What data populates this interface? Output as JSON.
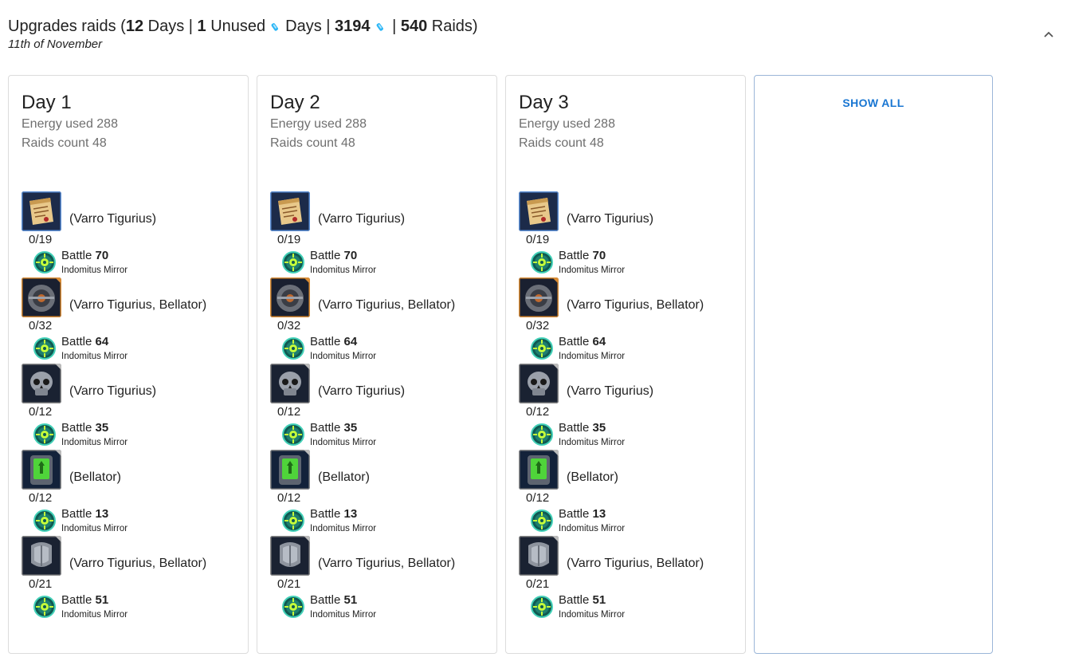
{
  "header": {
    "title_prefix": "Upgrades raids (",
    "days_value": "12",
    "days_label": " Days | ",
    "unused_value": "1",
    "unused_label": " Unused",
    "energy_days_label": "Days | ",
    "energy_total": "3194",
    "raids_sep": " | ",
    "raids_value": "540",
    "raids_label": " Raids)",
    "date": "11th of November",
    "energy_icon": "energy-icon",
    "collapse_icon": "chevron-up-icon"
  },
  "days": [
    {
      "title": "Day 1",
      "energy": "Energy used 288",
      "raids": "Raids count 48"
    },
    {
      "title": "Day 2",
      "energy": "Energy used 288",
      "raids": "Raids count 48"
    },
    {
      "title": "Day 3",
      "energy": "Energy used 288",
      "raids": "Raids count 48"
    }
  ],
  "upgrades": [
    {
      "icon": "scroll-icon",
      "rarity_color": "#5b8fd6",
      "characters": "(Varro Tigurius)",
      "progress": "0/19",
      "battle_label": "Battle ",
      "battle_number": "70",
      "campaign": "Indomitus Mirror"
    },
    {
      "icon": "armor-plate-icon",
      "rarity_color": "#d98b33",
      "characters": "(Varro Tigurius, Bellator)",
      "progress": "0/32",
      "battle_label": "Battle ",
      "battle_number": "64",
      "campaign": "Indomitus Mirror"
    },
    {
      "icon": "skull-icon",
      "rarity_color": "#8a8a8a",
      "characters": "(Varro Tigurius)",
      "progress": "0/12",
      "battle_label": "Battle ",
      "battle_number": "35",
      "campaign": "Indomitus Mirror"
    },
    {
      "icon": "data-slate-icon",
      "rarity_color": "#8a8a8a",
      "characters": "(Bellator)",
      "progress": "0/12",
      "battle_label": "Battle ",
      "battle_number": "13",
      "campaign": "Indomitus Mirror"
    },
    {
      "icon": "pauldron-icon",
      "rarity_color": "#8a8a8a",
      "characters": "(Varro Tigurius, Bellator)",
      "progress": "0/21",
      "battle_label": "Battle ",
      "battle_number": "51",
      "campaign": "Indomitus Mirror"
    }
  ],
  "location_icon": "campaign-location-icon",
  "show_all_label": "SHOW ALL"
}
